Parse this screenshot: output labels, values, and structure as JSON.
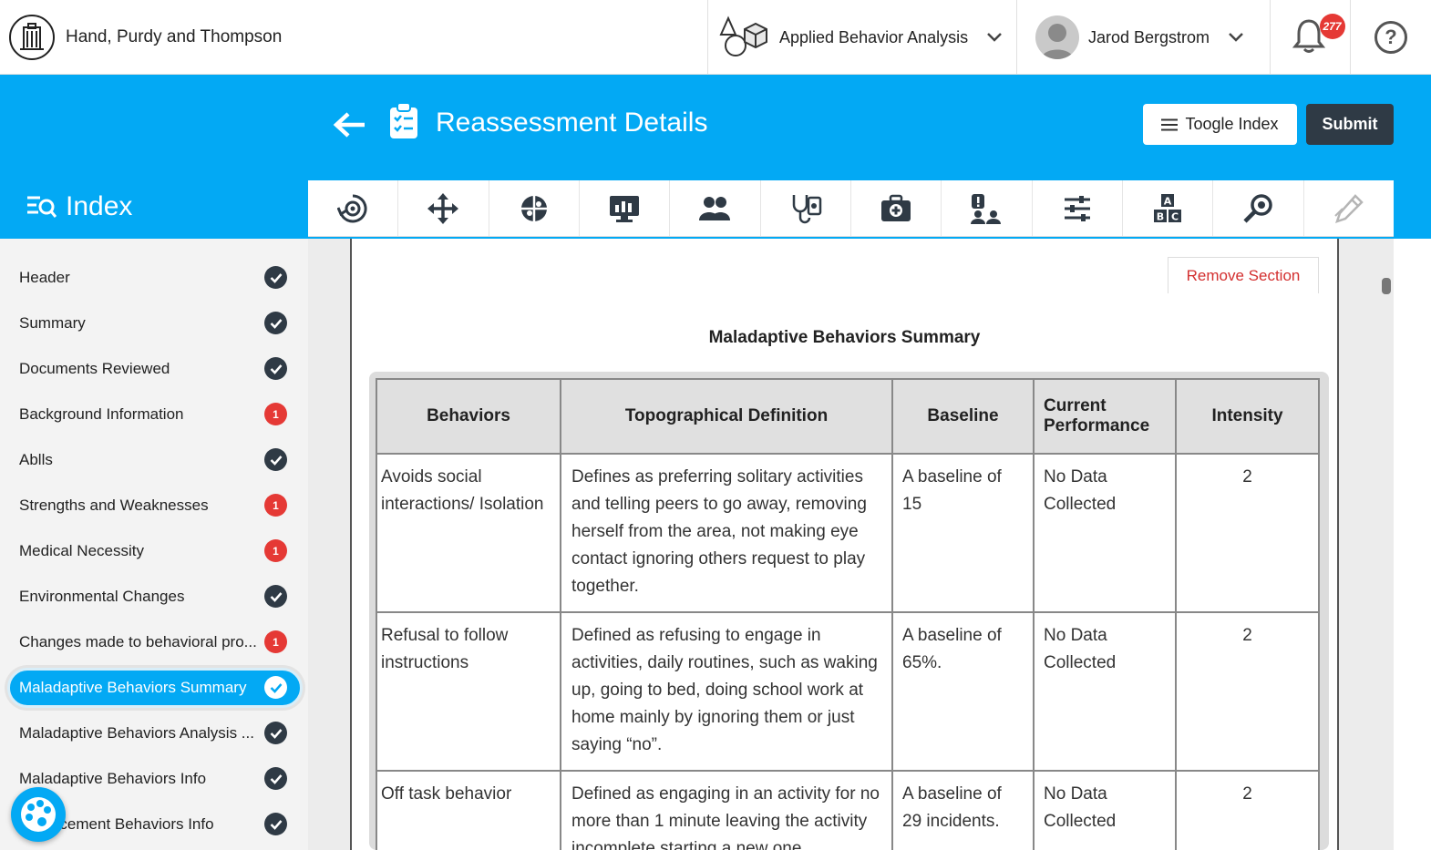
{
  "header": {
    "org_name": "Hand, Purdy and Thompson",
    "program": "Applied Behavior Analysis",
    "user_name": "Jarod Bergstrom",
    "notification_count": "277",
    "help_glyph": "?"
  },
  "page": {
    "title": "Reassessment Details",
    "toggle_index_label": "Toogle Index",
    "submit_label": "Submit",
    "index_title": "Index"
  },
  "toolbar": {
    "icons": [
      "cycle-gear-icon",
      "move-arrows-icon",
      "puzzle-brain-icon",
      "chart-monitor-icon",
      "group-people-icon",
      "stethoscope-clipboard-icon",
      "medical-kit-icon",
      "alert-person-icon",
      "sliders-icon",
      "abc-blocks-icon",
      "magnifier-icon",
      "pen-icon"
    ]
  },
  "sidebar": {
    "items": [
      {
        "label": "Header",
        "status": "done"
      },
      {
        "label": "Summary",
        "status": "done"
      },
      {
        "label": "Documents Reviewed",
        "status": "done"
      },
      {
        "label": "Background Information",
        "status": "alert",
        "badge": "1"
      },
      {
        "label": "Ablls",
        "status": "done"
      },
      {
        "label": "Strengths and Weaknesses",
        "status": "alert",
        "badge": "1"
      },
      {
        "label": "Medical Necessity",
        "status": "alert",
        "badge": "1"
      },
      {
        "label": "Environmental Changes",
        "status": "done"
      },
      {
        "label": "Changes made to behavioral pro...",
        "status": "alert",
        "badge": "1"
      },
      {
        "label": "Maladaptive Behaviors Summary",
        "status": "done",
        "active": true
      },
      {
        "label": "Maladaptive Behaviors Analysis ...",
        "status": "done"
      },
      {
        "label": "Maladaptive Behaviors Info",
        "status": "done"
      },
      {
        "label": "Replacement Behaviors Info",
        "status": "done"
      }
    ]
  },
  "section": {
    "remove_label": "Remove Section",
    "title": "Maladaptive Behaviors Summary",
    "table": {
      "headers": [
        "Behaviors",
        "Topographical Definition",
        "Baseline",
        "Current Performance",
        "Intensity"
      ],
      "rows": [
        [
          "Avoids social interactions/ Isolation",
          "Defines as preferring solitary activities and telling peers to go away, removing herself from the area, not making eye contact ignoring others request to play together.",
          "A baseline of 15",
          "No Data Collected",
          "2"
        ],
        [
          "Refusal to follow instructions",
          "Defined as refusing to engage in activities, daily routines, such as waking up, going to bed, doing school work at home mainly by ignoring them or just saying “no”.",
          "A baseline of 65%.",
          "No Data Collected",
          "2"
        ],
        [
          "Off task behavior",
          "Defined as engaging in an activity for no more than 1 minute leaving the activity incomplete starting a new one",
          "A baseline of 29 incidents.",
          "No Data Collected",
          "2"
        ]
      ]
    }
  },
  "colors": {
    "brand_blue": "#03a9f4",
    "dark": "#2f3a45",
    "alert_red": "#e53935",
    "remove_red": "#d32f2f"
  }
}
